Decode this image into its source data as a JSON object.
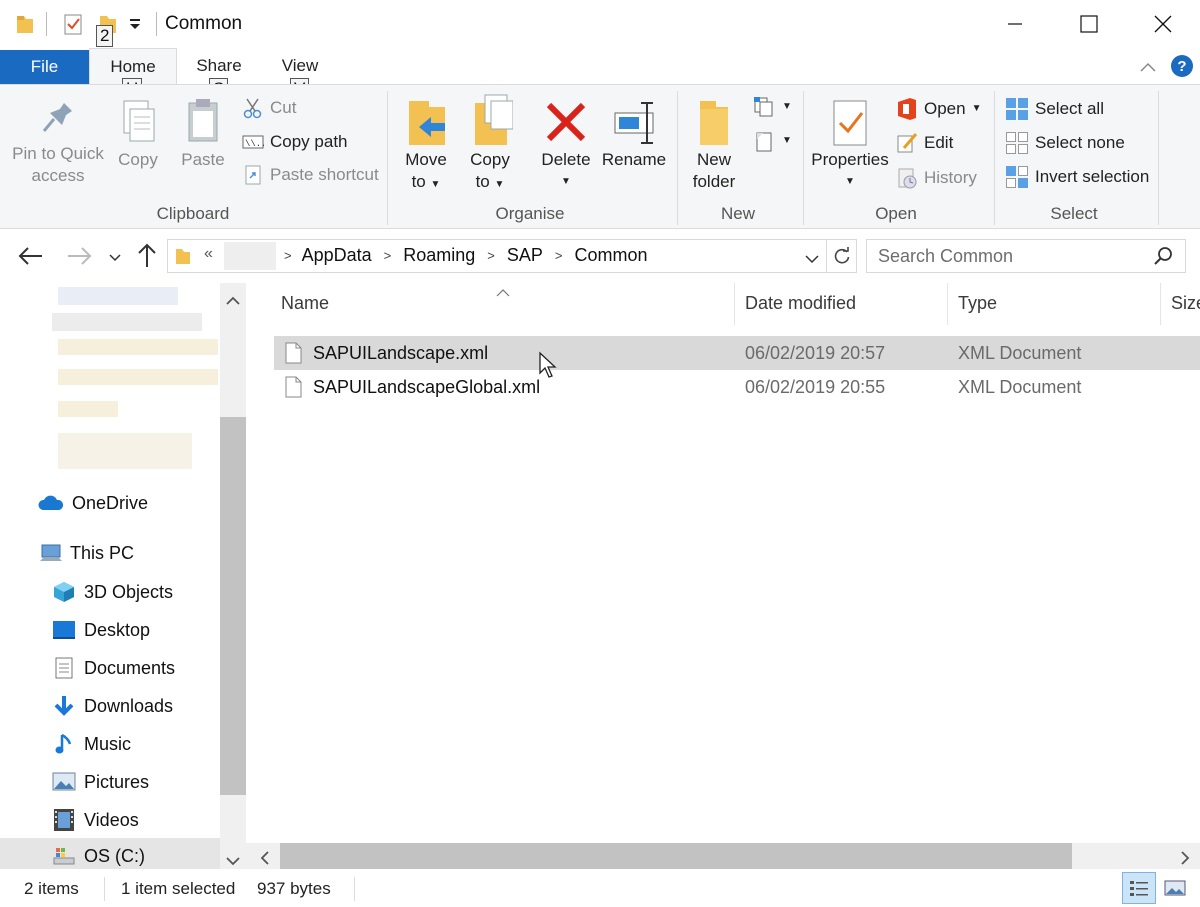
{
  "window": {
    "title": "Common",
    "keytips": {
      "qat": "2",
      "home": "H",
      "share": "S",
      "view": "V"
    }
  },
  "tabs": [
    {
      "label": "File"
    },
    {
      "label": "Home"
    },
    {
      "label": "Share"
    },
    {
      "label": "View"
    }
  ],
  "ribbon": {
    "clipboard": {
      "pin_label_1": "Pin to Quick",
      "pin_label_2": "access",
      "copy": "Copy",
      "paste": "Paste",
      "cut": "Cut",
      "copy_path": "Copy path",
      "paste_shortcut": "Paste shortcut",
      "group": "Clipboard"
    },
    "organise": {
      "move_1": "Move",
      "move_2": "to",
      "copy_1": "Copy",
      "copy_2": "to",
      "delete": "Delete",
      "rename": "Rename",
      "group": "Organise"
    },
    "new": {
      "new_folder_1": "New",
      "new_folder_2": "folder",
      "group": "New"
    },
    "open": {
      "properties": "Properties",
      "open": "Open",
      "edit": "Edit",
      "history": "History",
      "group": "Open"
    },
    "select": {
      "select_all": "Select all",
      "select_none": "Select none",
      "invert": "Invert selection",
      "group": "Select"
    }
  },
  "address": {
    "overflow": "«",
    "crumbs": [
      "AppData",
      "Roaming",
      "SAP",
      "Common"
    ],
    "search_placeholder": "Search Common"
  },
  "nav": {
    "onedrive": "OneDrive",
    "thispc": "This PC",
    "items": [
      {
        "label": "3D Objects",
        "icon": "3d-objects-icon"
      },
      {
        "label": "Desktop",
        "icon": "desktop-icon"
      },
      {
        "label": "Documents",
        "icon": "documents-icon"
      },
      {
        "label": "Downloads",
        "icon": "downloads-icon"
      },
      {
        "label": "Music",
        "icon": "music-icon"
      },
      {
        "label": "Pictures",
        "icon": "pictures-icon"
      },
      {
        "label": "Videos",
        "icon": "videos-icon"
      },
      {
        "label": "OS (C:)",
        "icon": "drive-icon"
      }
    ]
  },
  "columns": {
    "name": "Name",
    "date": "Date modified",
    "type": "Type",
    "size": "Size"
  },
  "files": [
    {
      "name": "SAPUILandscape.xml",
      "date": "06/02/2019 20:57",
      "type": "XML Document",
      "selected": true
    },
    {
      "name": "SAPUILandscapeGlobal.xml",
      "date": "06/02/2019 20:55",
      "type": "XML Document",
      "selected": false
    }
  ],
  "status": {
    "items": "2 items",
    "selected": "1 item selected",
    "size": "937 bytes"
  },
  "colors": {
    "accent": "#1a6ac2",
    "selection": "#d9d9d9",
    "folder": "#f3c052"
  }
}
